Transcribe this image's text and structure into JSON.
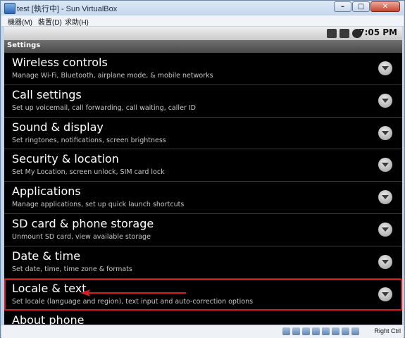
{
  "window": {
    "title": "test [執行中] - Sun VirtualBox"
  },
  "menubar": {
    "items": [
      "機器(M)",
      "裝置(D)",
      "求助(H)"
    ]
  },
  "statusbar": {
    "time": "7:05 PM"
  },
  "screen": {
    "title": "Settings"
  },
  "settings": {
    "items": [
      {
        "title": "Wireless controls",
        "subtitle": "Manage Wi-Fi, Bluetooth, airplane mode, & mobile networks"
      },
      {
        "title": "Call settings",
        "subtitle": "Set up voicemail, call forwarding, call waiting, caller ID"
      },
      {
        "title": "Sound & display",
        "subtitle": "Set ringtones, notifications, screen brightness"
      },
      {
        "title": "Security & location",
        "subtitle": "Set My Location, screen unlock, SIM card lock"
      },
      {
        "title": "Applications",
        "subtitle": "Manage applications, set up quick launch shortcuts"
      },
      {
        "title": "SD card & phone storage",
        "subtitle": "Unmount SD card, view available storage"
      },
      {
        "title": "Date & time",
        "subtitle": "Set date, time, time zone & formats"
      },
      {
        "title": "Locale & text",
        "subtitle": "Set locale (language and region), text input and auto-correction options"
      },
      {
        "title": "About phone",
        "subtitle": ""
      }
    ]
  },
  "vbox_status": {
    "host_key": "Right Ctrl"
  },
  "colors": {
    "highlight": "#d41e1e"
  }
}
